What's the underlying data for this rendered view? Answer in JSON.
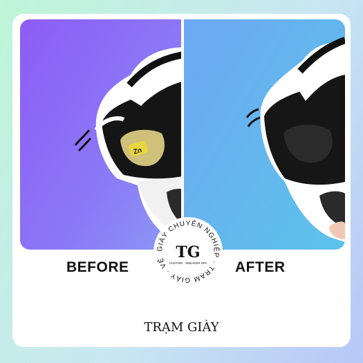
{
  "labels": {
    "before": "BEFORE",
    "after": "AFTER"
  },
  "seal": {
    "ring_text": "GIÀY CHUYÊN NGHIỆP · TRẠM GIÀY · VỆ",
    "monogram": "TG",
    "sub_text": "CUSTOM · SNEAKER SPA"
  },
  "footer": {
    "brand": "TRẠM GIÀY"
  },
  "shoe_badge": "Zn",
  "colors": {
    "before_bg": "#8d5cf6",
    "after_bg": "#5cc3ea",
    "card": "#ffffff"
  },
  "icons": {
    "before_image": "shoe-photo-before",
    "after_image": "shoe-photo-after",
    "seal": "brand-seal-icon"
  }
}
